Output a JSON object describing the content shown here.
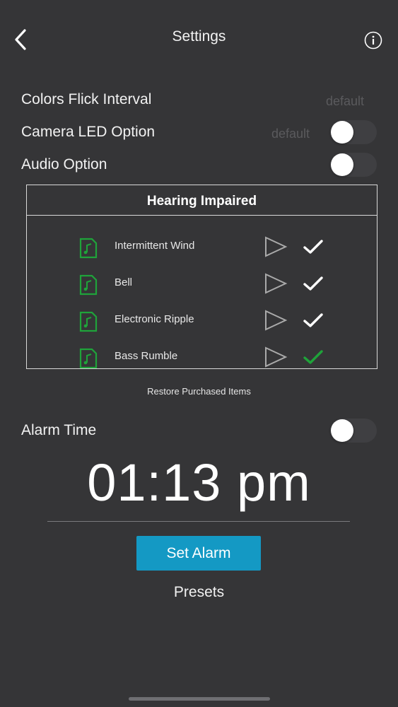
{
  "header": {
    "title": "Settings",
    "back_icon": "chevron-left-icon",
    "info_icon": "info-icon"
  },
  "settings": {
    "colors_flick": {
      "label": "Colors Flick Interval",
      "value": "default"
    },
    "camera_led": {
      "label": "Camera LED Option",
      "value": "default",
      "enabled": false
    },
    "audio": {
      "label": "Audio Option",
      "enabled": false
    }
  },
  "sounds_panel": {
    "title": "Hearing Impaired",
    "items": [
      {
        "name": "Intermittent Wind",
        "selected": false
      },
      {
        "name": "Bell",
        "selected": false
      },
      {
        "name": "Electronic Ripple",
        "selected": false
      },
      {
        "name": "Bass Rumble",
        "selected": true
      }
    ]
  },
  "restore_label": "Restore Purchased Items",
  "alarm": {
    "label": "Alarm Time",
    "enabled": false,
    "time": "01:13 pm",
    "set_label": "Set Alarm"
  },
  "presets_label": "Presets",
  "colors": {
    "background": "#353537",
    "accent": "#1499c4",
    "icon_green": "#1fa33a",
    "check_selected": "#1fa33a",
    "check_default": "#ffffff"
  }
}
